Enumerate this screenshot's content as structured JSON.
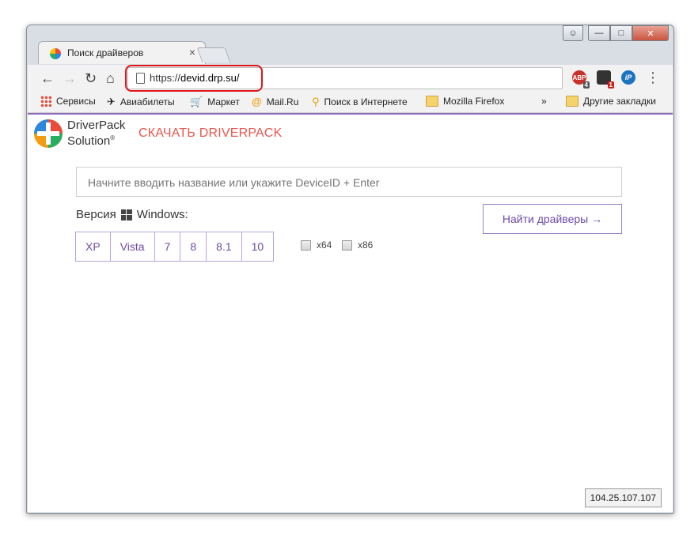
{
  "browser": {
    "tab_title": "Поиск драйверов",
    "url_scheme": "https://",
    "url_host": "devid.drp.su/",
    "extensions": [
      {
        "name": "adblock",
        "label": "ABP",
        "badge": "4",
        "color": "#c9302c"
      },
      {
        "name": "ext-2",
        "label": "",
        "badge": "1",
        "color": "#333333"
      },
      {
        "name": "ip-ext",
        "label": "iP",
        "badge": "",
        "color": "#1e73be"
      }
    ],
    "bookmarks": [
      {
        "label": "Сервисы",
        "icon": "apps-grid-icon"
      },
      {
        "label": "Авиабилеты",
        "icon": "plane-icon"
      },
      {
        "label": "Маркет",
        "icon": "cart-icon"
      },
      {
        "label": "Mail.Ru",
        "icon": "mailru-icon"
      },
      {
        "label": "Поиск в Интернете",
        "icon": "search-icon"
      },
      {
        "label": "Mozilla Firefox",
        "icon": "folder-icon"
      }
    ],
    "bookmarks_overflow": "»",
    "other_bookmarks": "Другие закладки"
  },
  "site": {
    "logo_line1": "DriverPack",
    "logo_line2": "Solution",
    "logo_mark": "®",
    "download_link": "СКАЧАТЬ DRIVERPACK",
    "search_placeholder": "Начните вводить название или укажите DeviceID + Enter",
    "version_label": "Версия",
    "windows_label": "Windows:",
    "os_versions": [
      "XP",
      "Vista",
      "7",
      "8",
      "8.1",
      "10"
    ],
    "arch_x64": "x64",
    "arch_x86": "x86",
    "find_button": "Найти драйверы →",
    "ip_address": "104.25.107.107"
  },
  "colors": {
    "accent_purple": "#6e4aa8",
    "download_red": "#e8574f",
    "highlight_red": "#e0141a"
  }
}
